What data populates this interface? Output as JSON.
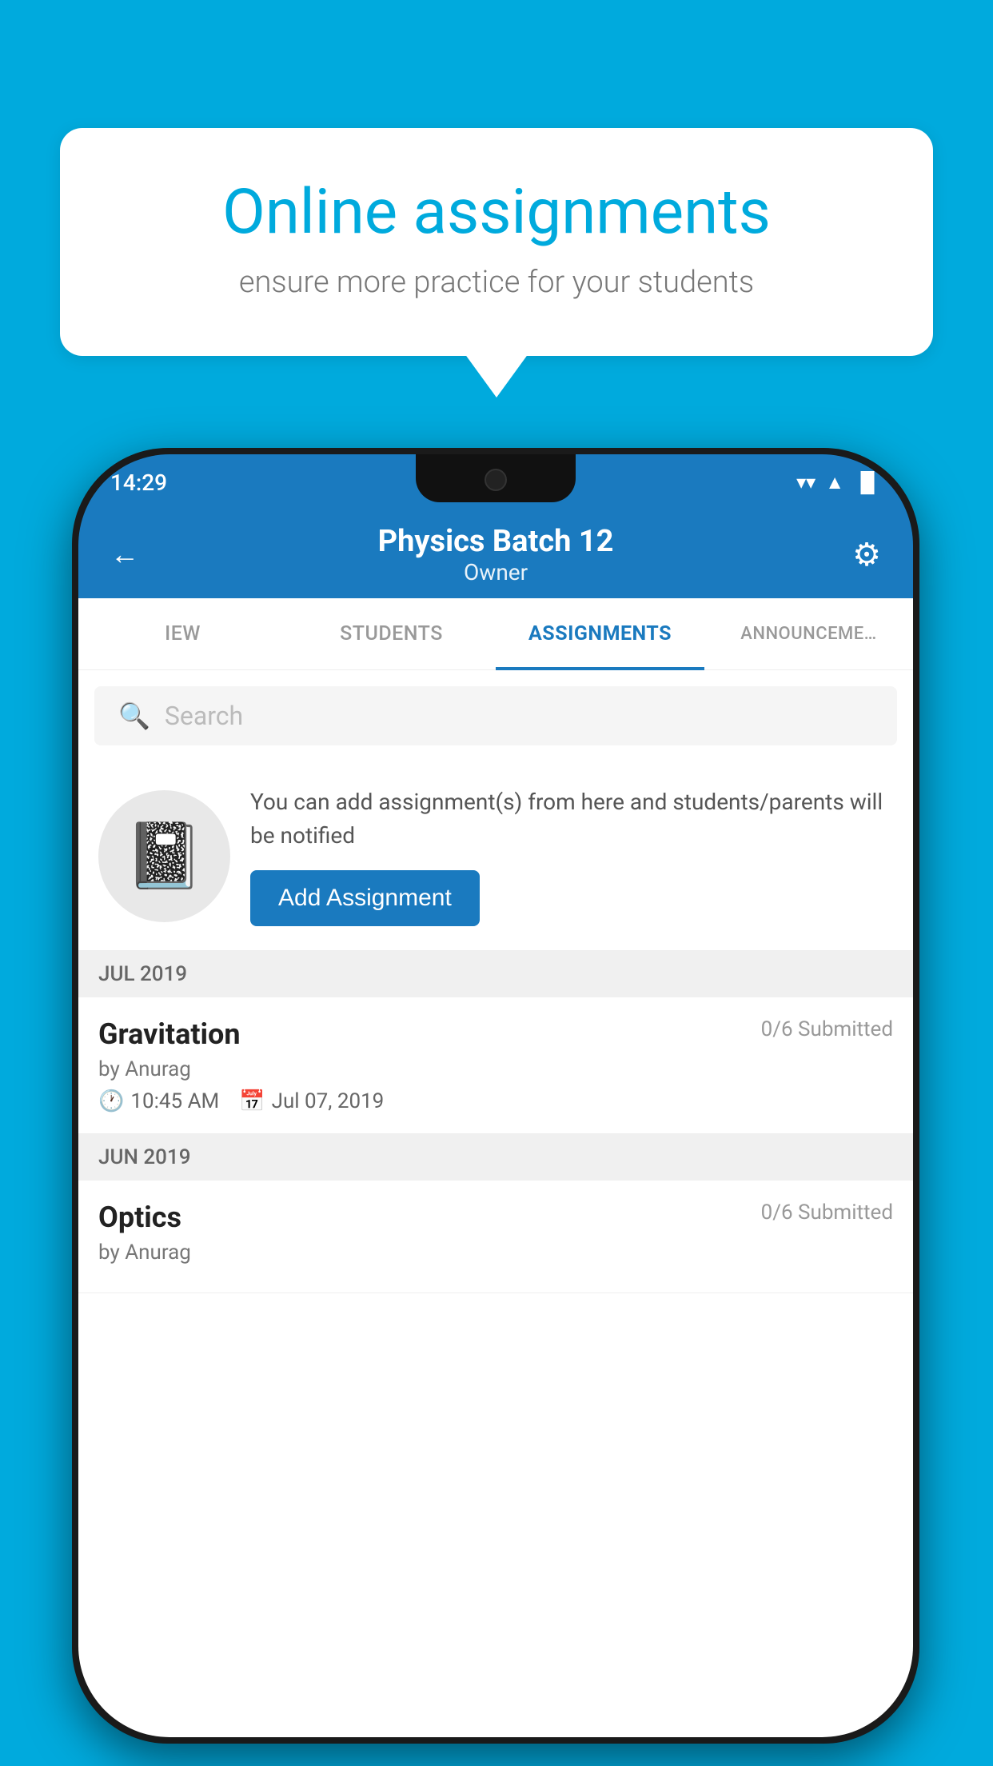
{
  "background_color": "#00AADD",
  "speech_bubble": {
    "heading": "Online assignments",
    "subtext": "ensure more practice for your students"
  },
  "status_bar": {
    "time": "14:29",
    "wifi": "▲",
    "signal": "▲",
    "battery": "▐"
  },
  "app_bar": {
    "title": "Physics Batch 12",
    "subtitle": "Owner",
    "back_label": "←",
    "settings_label": "⚙"
  },
  "tabs": [
    {
      "label": "IEW",
      "active": false
    },
    {
      "label": "STUDENTS",
      "active": false
    },
    {
      "label": "ASSIGNMENTS",
      "active": true
    },
    {
      "label": "ANNOUNCEME…",
      "active": false
    }
  ],
  "search": {
    "placeholder": "Search"
  },
  "promo": {
    "text": "You can add assignment(s) from here and students/parents will be notified",
    "button_label": "Add Assignment"
  },
  "sections": [
    {
      "header": "JUL 2019",
      "assignments": [
        {
          "title": "Gravitation",
          "submitted": "0/6 Submitted",
          "by": "by Anurag",
          "time": "10:45 AM",
          "date": "Jul 07, 2019"
        }
      ]
    },
    {
      "header": "JUN 2019",
      "assignments": [
        {
          "title": "Optics",
          "submitted": "0/6 Submitted",
          "by": "by Anurag",
          "time": "",
          "date": ""
        }
      ]
    }
  ]
}
